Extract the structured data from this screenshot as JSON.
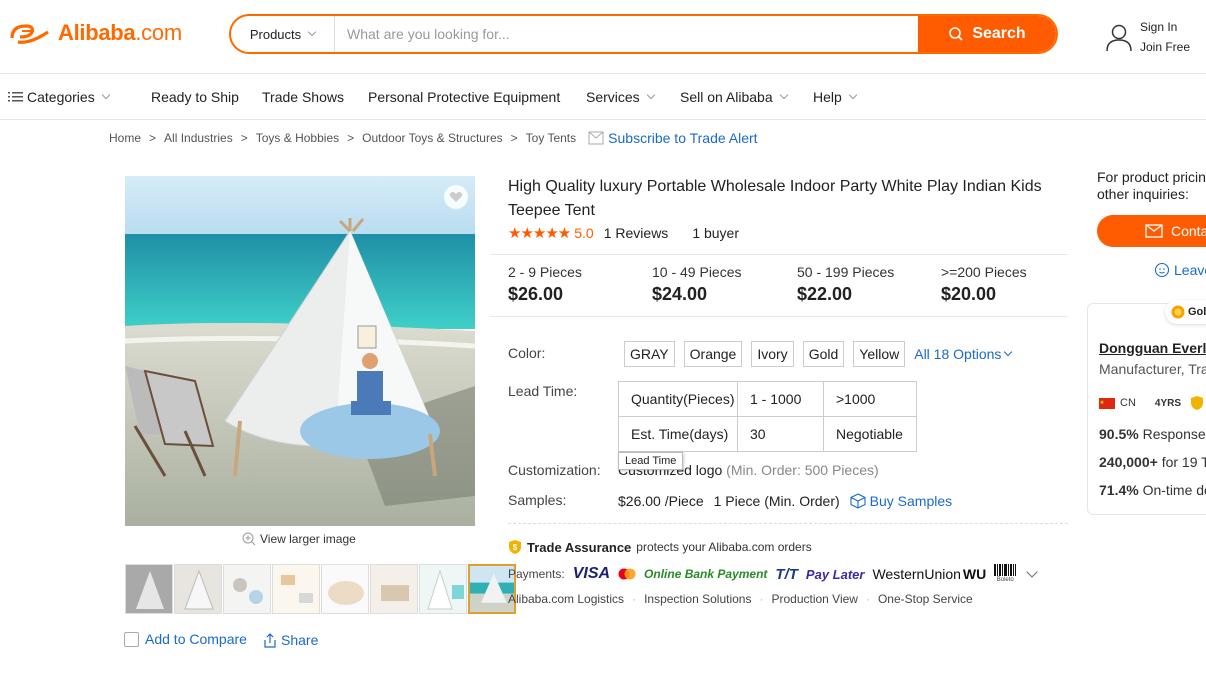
{
  "header": {
    "logo_text": "Alibaba",
    "logo_suffix": ".com",
    "search_category": "Products",
    "search_placeholder": "What are you looking for...",
    "search_button": "Search",
    "sign_in": "Sign In",
    "join_free": "Join Free"
  },
  "nav": {
    "categories": "Categories",
    "items": [
      "Ready to Ship",
      "Trade Shows",
      "Personal Protective Equipment",
      "Services",
      "Sell on Alibaba",
      "Help"
    ]
  },
  "breadcrumb": {
    "items": [
      "Home",
      "All Industries",
      "Toys & Hobbies",
      "Outdoor Toys & Structures",
      "Toy Tents"
    ],
    "subscribe": "Subscribe to Trade Alert"
  },
  "gallery": {
    "view_larger": "View larger image",
    "add_to_compare": "Add to Compare",
    "share": "Share"
  },
  "product": {
    "title": "High Quality luxury Portable Wholesale Indoor Party White Play Indian Kids Teepee Tent",
    "rating": "5.0",
    "reviews": "1 Reviews",
    "buyers": "1 buyer",
    "stars": 5,
    "price_tiers": [
      {
        "qty": "2 - 9 Pieces",
        "price": "$26.00"
      },
      {
        "qty": "10 - 49 Pieces",
        "price": "$24.00"
      },
      {
        "qty": "50 - 199 Pieces",
        "price": "$22.00"
      },
      {
        "qty": ">=200 Pieces",
        "price": "$20.00"
      }
    ],
    "color_label": "Color:",
    "colors": [
      "GRAY",
      "Orange",
      "Ivory",
      "Gold",
      "Yellow"
    ],
    "all_options": "All 18 Options",
    "lead_time_label": "Lead Time:",
    "lead_time_table": {
      "row1": [
        "Quantity(Pieces)",
        "1 - 1000",
        ">1000"
      ],
      "row2": [
        "Est. Time(days)",
        "30",
        "Negotiable"
      ]
    },
    "lead_time_tooltip": "Lead Time",
    "customization_label": "Customization:",
    "customization_value": "Customized logo",
    "customization_min": "(Min. Order: 500 Pieces)",
    "samples_label": "Samples:",
    "sample_price": "$26.00 /Piece",
    "sample_min": "1 Piece (Min. Order)",
    "buy_samples": "Buy Samples",
    "trade_assurance": "Trade Assurance",
    "trade_assurance_desc": "protects your Alibaba.com orders",
    "payments_label": "Payments:",
    "payments": [
      "VISA",
      "Online Bank Payment",
      "T/T",
      "Pay Later",
      "WesternUnion",
      "WU",
      "Boleto"
    ],
    "services": [
      "Alibaba.com Logistics",
      "Inspection Solutions",
      "Production View",
      "One-Stop Service"
    ]
  },
  "supplier": {
    "inquiry_text": "For product pricin other inquiries:",
    "contact": "Conta",
    "leave": "Leave",
    "badge": "Gol",
    "name": "Dongguan Everlea",
    "type": "Manufacturer, Tra",
    "country": "CN",
    "years": "4YRS",
    "response_rate": "90.5%",
    "response_label": "Response",
    "transactions": "240,000+",
    "transactions_label": "for 19 T",
    "ontime": "71.4%",
    "ontime_label": "On-time de"
  },
  "colors_theme": {
    "brand": "#ff6a00",
    "link": "#1a6ac9",
    "star": "#ff5b00"
  }
}
